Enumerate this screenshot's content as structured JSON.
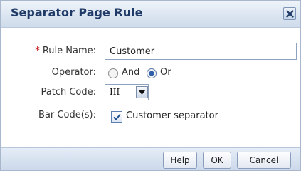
{
  "dialog": {
    "title": "Separator Page Rule",
    "close_icon": "close-icon"
  },
  "form": {
    "rule_name": {
      "required_marker": "*",
      "label": "Rule Name:",
      "value": "Customer"
    },
    "operator": {
      "label": "Operator:",
      "options": [
        {
          "label": "And",
          "selected": false
        },
        {
          "label": "Or",
          "selected": true
        }
      ]
    },
    "patch_code": {
      "label": "Patch Code:",
      "value": "III",
      "dropdown_icon": "chevron-down-icon"
    },
    "bar_codes": {
      "label": "Bar Code(s):",
      "options": [
        {
          "label": "Customer separator",
          "checked": true
        }
      ]
    }
  },
  "footer": {
    "help_label": "Help",
    "ok_label": "OK",
    "cancel_label": "Cancel"
  }
}
